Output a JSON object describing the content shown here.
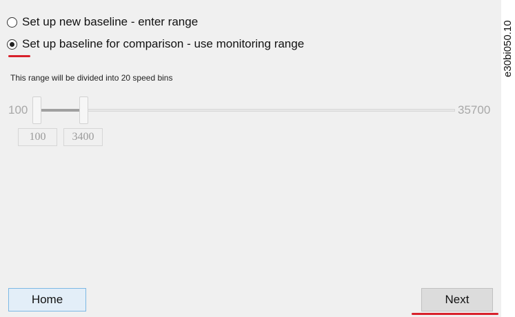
{
  "options": [
    {
      "label": "Set up new baseline - enter range",
      "selected": false
    },
    {
      "label": "Set up baseline for comparison - use monitoring range",
      "selected": true
    }
  ],
  "info_text": "This range will be divided into 20 speed bins",
  "slider": {
    "min_label": "100",
    "max_label": "35700",
    "low_value": "100",
    "high_value": "3400"
  },
  "buttons": {
    "home_label": "Home",
    "next_label": "Next"
  },
  "figure_code": "e30bi050.10",
  "colors": {
    "highlight": "#d8202a",
    "home_border": "#7cb8e4"
  }
}
